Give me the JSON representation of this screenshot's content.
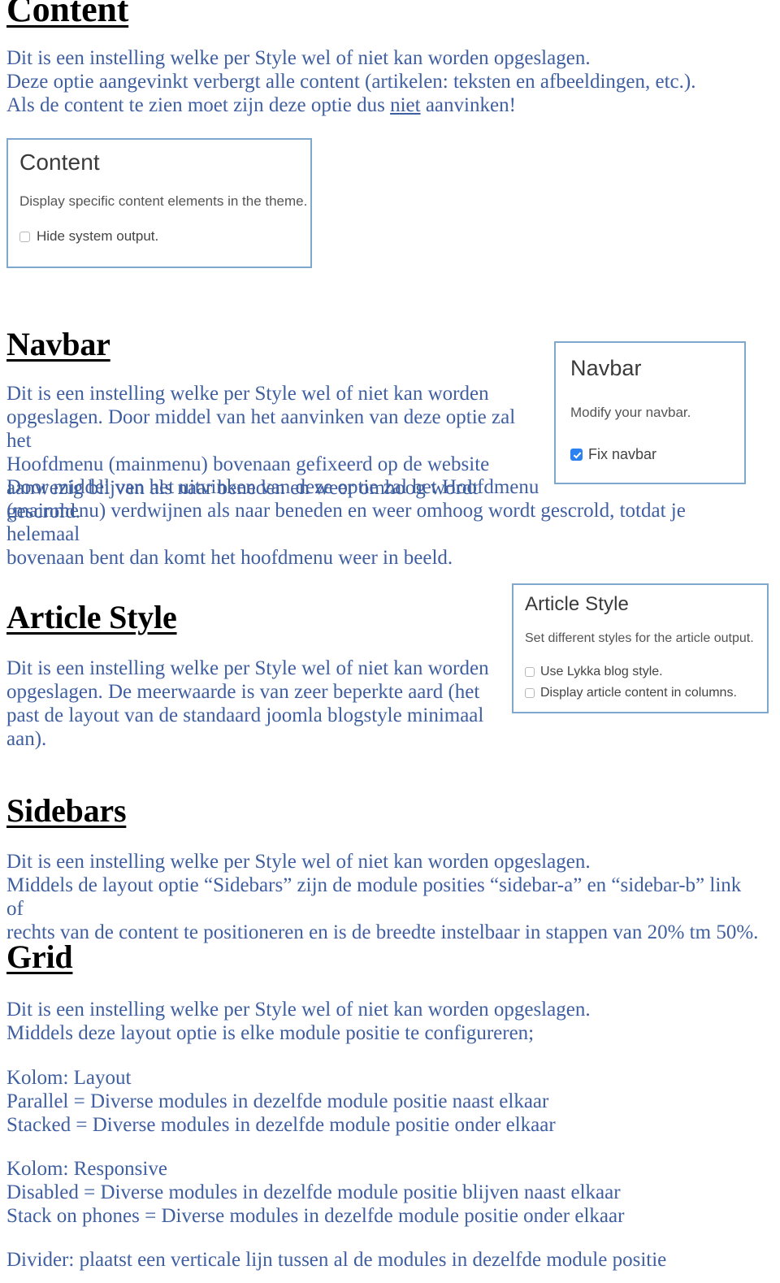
{
  "document": {
    "language": "nl",
    "text_color": "#3f5fa0",
    "heading_color": "#000000",
    "panel_border_color": "#7ea8cd",
    "checkbox_checked_color": "#2b82f0"
  },
  "sections": {
    "content": {
      "heading": "Content",
      "paragraph_line1": "Dit is een instelling welke per Style wel of niet kan worden opgeslagen.",
      "paragraph_line2": "Deze optie aangevinkt verbergt alle content (artikelen: teksten en afbeeldingen, etc.).",
      "paragraph_line3_before": "Als de content te zien moet zijn deze optie dus ",
      "paragraph_line3_underlined": "niet",
      "paragraph_line3_after": " aanvinken!",
      "screenshot": {
        "title": "Content",
        "description": "Display specific content elements in the theme.",
        "checkbox_label": "Hide system output.",
        "checkbox_checked": "false"
      }
    },
    "navbar": {
      "heading": "Navbar",
      "paragraph_a": "Dit is een instelling welke per Style wel of niet kan worden\nopgeslagen. Door middel van het aanvinken van deze optie zal het\nHoofdmenu (mainmenu) bovenaan gefixeerd op de website\naanwezig blijven als naar beneden en weer omhoog wordt gescrold.",
      "paragraph_b": "Door middel van het uitvinken van deze optie zal het Hoofdmenu\n(mainmenu) verdwijnen als naar beneden en weer omhoog wordt gescrold, totdat je helemaal\nbovenaan bent dan komt het hoofdmenu weer in beeld.",
      "screenshot": {
        "title": "Navbar",
        "description": "Modify your navbar.",
        "checkbox_label": "Fix navbar",
        "checkbox_checked": "true"
      }
    },
    "article_style": {
      "heading": "Article Style",
      "paragraph": "Dit is een instelling welke per Style wel of niet kan worden\nopgeslagen. De meerwaarde is van zeer beperkte aard (het\npast de layout van de standaard joomla blogstyle minimaal\naan).",
      "screenshot": {
        "title": "Article Style",
        "description": "Set different styles for the article output.",
        "checkbox1_label": "Use Lykka blog style.",
        "checkbox1_checked": "false",
        "checkbox2_label": "Display article content in columns.",
        "checkbox2_checked": "false"
      }
    },
    "sidebars": {
      "heading": "Sidebars",
      "paragraph": "Dit is een instelling welke per Style wel of niet kan worden opgeslagen.\nMiddels de layout optie “Sidebars” zijn de module posities “sidebar-a” en “sidebar-b” link of\nrechts van de content te positioneren en is de breedte instelbaar in stappen van 20% tm 50%."
    },
    "grid": {
      "heading": "Grid",
      "paragraph": "Dit is een instelling welke per Style wel of niet kan worden opgeslagen.\nMiddels deze layout optie is elke module positie te configureren;",
      "kolom_layout": "Kolom: Layout\nParallel = Diverse modules in dezelfde module positie naast elkaar\nStacked = Diverse modules in dezelfde module positie onder elkaar",
      "kolom_responsive": "Kolom: Responsive\nDisabled = Diverse modules in dezelfde module positie blijven naast elkaar\nStack on phones = Diverse modules in dezelfde module positie onder elkaar",
      "divider": "Divider: plaatst een verticale lijn tussen al de modules in dezelfde module positie"
    }
  }
}
